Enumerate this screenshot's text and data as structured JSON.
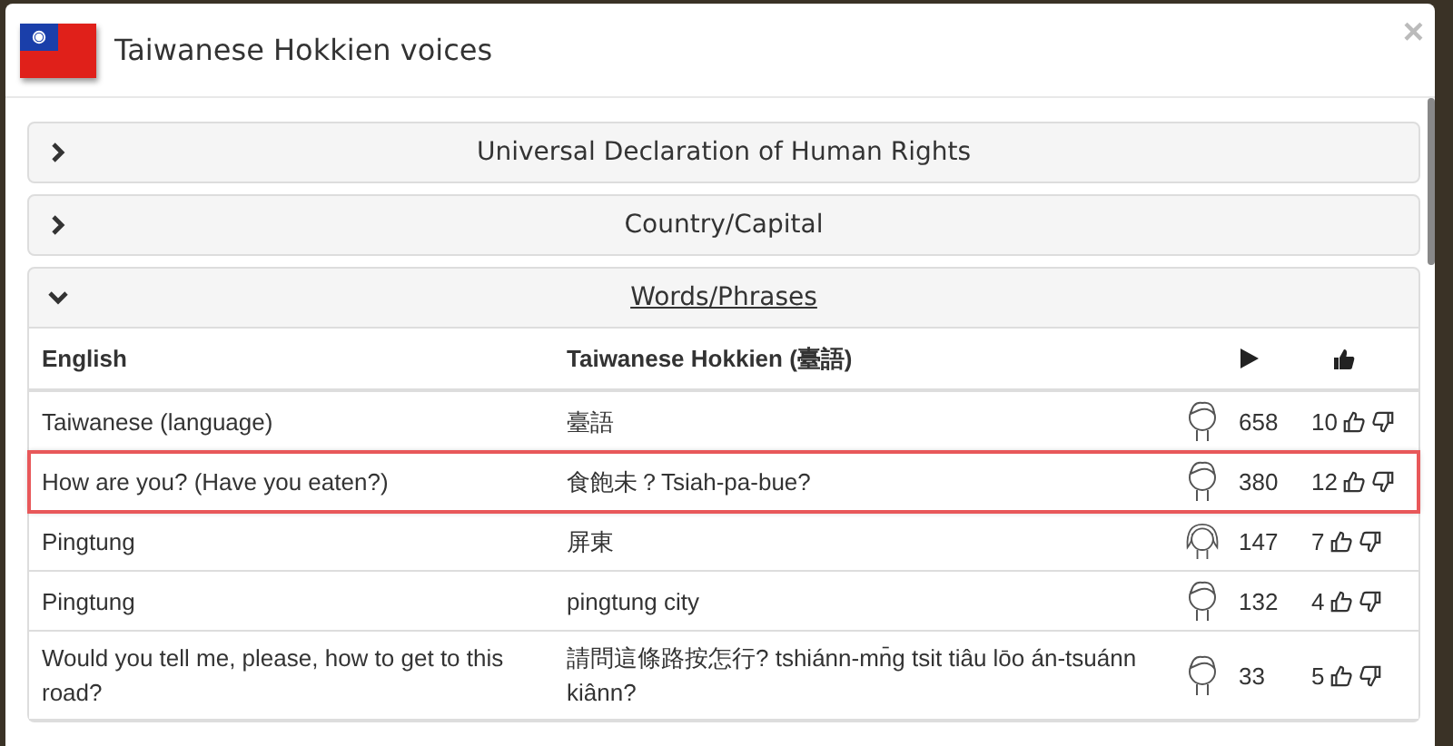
{
  "dialog": {
    "title": "Taiwanese Hokkien voices",
    "close": "×"
  },
  "sections": [
    {
      "title": "Universal Declaration of Human Rights",
      "expanded": false
    },
    {
      "title": "Country/Capital",
      "expanded": false
    },
    {
      "title": "Words/Phrases",
      "expanded": true
    }
  ],
  "table": {
    "columns": [
      "English",
      "Taiwanese Hokkien (臺語)"
    ],
    "rows": [
      {
        "english": "Taiwanese (language)",
        "hokkien": "臺語",
        "kind": "male",
        "plays": "658",
        "likes": "10",
        "selected": false
      },
      {
        "english": "How are you? (Have you eaten?)",
        "hokkien": "食飽未？Tsiah-pa-bue?",
        "kind": "male",
        "plays": "380",
        "likes": "12",
        "selected": true
      },
      {
        "english": "Pingtung",
        "hokkien": "屏東",
        "kind": "female",
        "plays": "147",
        "likes": "7",
        "selected": false
      },
      {
        "english": "Pingtung",
        "hokkien": "pingtung city",
        "kind": "male",
        "plays": "132",
        "likes": "4",
        "selected": false
      },
      {
        "english": "Would you tell me, please, how to get to this road?",
        "hokkien": "請問這條路按怎行? tshiánn-mn̄g tsit tiâu lōo án-tsuánn kiânn?",
        "kind": "male",
        "plays": "33",
        "likes": "5",
        "selected": false
      }
    ]
  }
}
